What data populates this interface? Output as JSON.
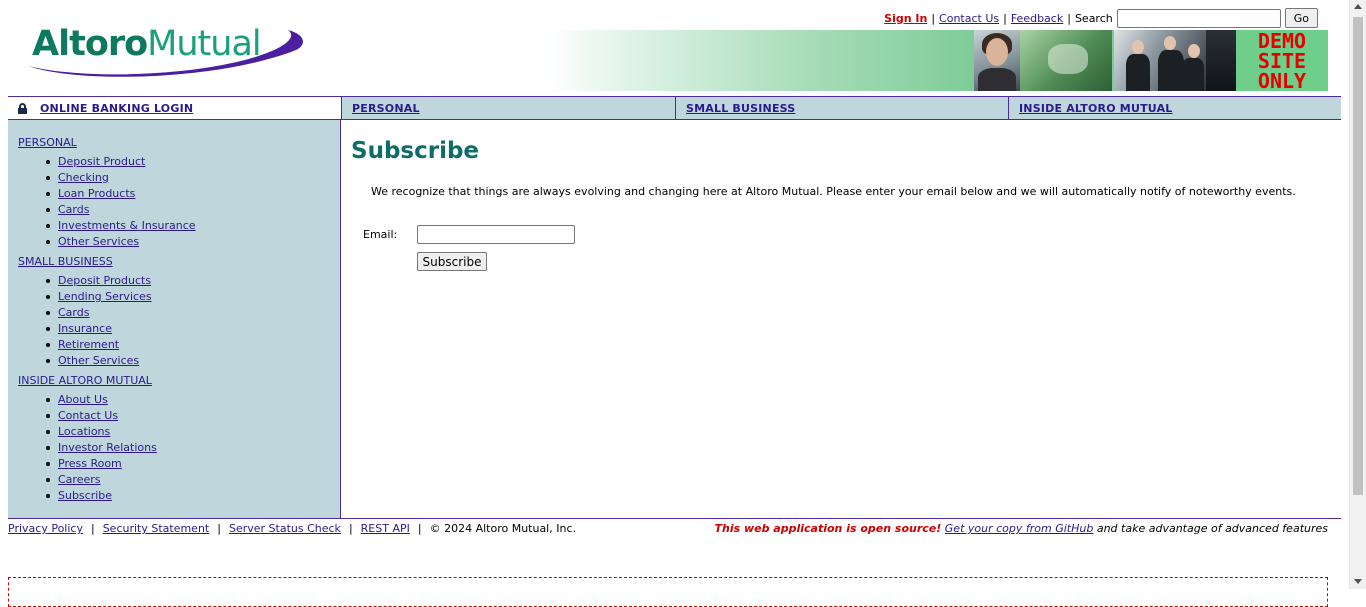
{
  "header": {
    "logo_part1": "Altoro",
    "logo_part2": "Mutual",
    "links": {
      "signin": "Sign In",
      "contact": "Contact Us",
      "feedback": "Feedback",
      "search_label": "Search",
      "separator": "|"
    },
    "search": {
      "value": "",
      "placeholder": ""
    },
    "go_button": "Go",
    "demo_line1": "DEMO",
    "demo_line2": "SITE",
    "demo_line3": "ONLY"
  },
  "nav": {
    "login": "ONLINE BANKING LOGIN",
    "personal": "PERSONAL",
    "small_business": "SMALL BUSINESS",
    "inside": "INSIDE ALTORO MUTUAL"
  },
  "sidebar": {
    "groups": [
      {
        "title": "PERSONAL",
        "items": [
          "Deposit Product",
          "Checking",
          "Loan Products",
          "Cards",
          "Investments & Insurance",
          "Other Services"
        ]
      },
      {
        "title": "SMALL BUSINESS",
        "items": [
          "Deposit Products",
          "Lending Services",
          "Cards",
          "Insurance",
          "Retirement",
          "Other Services"
        ]
      },
      {
        "title": "INSIDE ALTORO MUTUAL",
        "items": [
          "About Us",
          "Contact Us",
          "Locations",
          "Investor Relations",
          "Press Room",
          "Careers",
          "Subscribe"
        ]
      }
    ]
  },
  "main": {
    "title": "Subscribe",
    "intro": "We recognize that things are always evolving and changing here at Altoro Mutual. Please enter your email below and we will automatically notify of noteworthy events.",
    "email_label": "Email:",
    "email_value": "",
    "subscribe_button": "Subscribe"
  },
  "footer": {
    "links": [
      "Privacy Policy",
      "Security Statement",
      "Server Status Check",
      "REST API"
    ],
    "separator": "|",
    "copyright": "© 2024 Altoro Mutual, Inc.",
    "oss_text": "This web application is open source!",
    "github_link": "Get your copy from GitHub",
    "tail_text": "and take advantage of advanced features"
  },
  "colors": {
    "brand_green": "#0d7a5f",
    "nav_bg": "#bfd6dc",
    "border_purple": "#4b2aa0",
    "link": "#2b1a8c",
    "signin_red": "#cc0000",
    "title_teal": "#0d6e67"
  }
}
